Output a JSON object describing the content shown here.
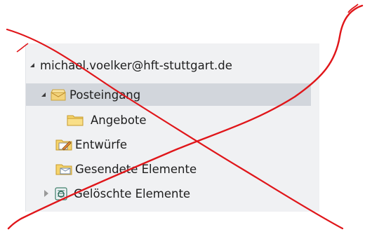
{
  "folder_pane": {
    "account": "michael.voelker@hft-stuttgart.de",
    "folders": [
      {
        "label": "Posteingang",
        "icon": "inbox-icon",
        "state": "expanded",
        "selected": true
      },
      {
        "label": "Angebote",
        "icon": "folder-icon"
      },
      {
        "label": "Entwürfe",
        "icon": "drafts-icon"
      },
      {
        "label": "Gesendete Elemente",
        "icon": "sent-items-icon"
      },
      {
        "label": "Gelöschte Elemente",
        "icon": "deleted-items-icon",
        "state": "collapsed"
      }
    ]
  },
  "colors": {
    "pane_background": "#f0f1f3",
    "selection": "#d2d6dc",
    "strike_overlay": "#e0161a"
  },
  "overlay": {
    "icon": "red-x-strikethrough-icon"
  }
}
